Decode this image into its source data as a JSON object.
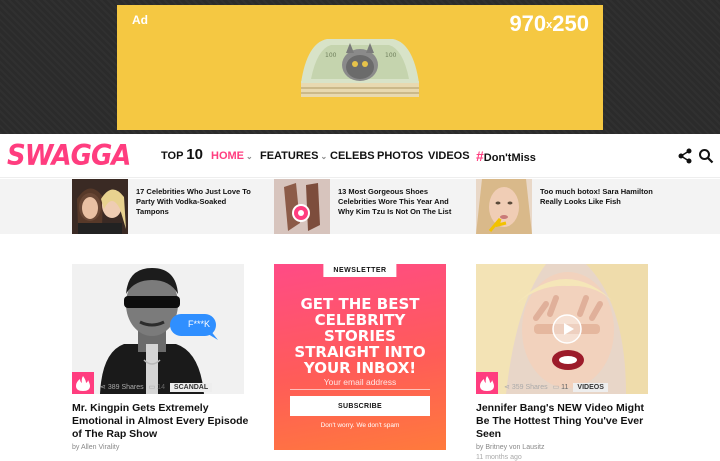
{
  "ad": {
    "label": "Ad",
    "size": "970",
    "size_x": "x",
    "size_h": "250"
  },
  "nav": {
    "logo": "SWAGGA",
    "top": "TOP",
    "top_num": "10",
    "home": "HOME",
    "features": "FEATURES",
    "celebs": "CELEBS",
    "photos": "PHOTOS",
    "videos": "VIDEOS",
    "hash": "#",
    "dontmiss": "Don'tMiss"
  },
  "trending": [
    {
      "title": "17 Celebrities Who Just Love To Party With Vodka-Soaked Tampons"
    },
    {
      "title": "13 Most Gorgeous Shoes Celebrities Wore This Year And Why Kim Tzu Is Not On The List"
    },
    {
      "title": "Too much botox! Sara Hamilton Really Looks Like Fish"
    }
  ],
  "cards": [
    {
      "bubble": "F***K",
      "shares": "389 Shares",
      "comments": "14",
      "tag": "SCANDAL",
      "title": "Mr. Kingpin Gets Extremely Emotional in Almost Every Episode of The Rap Show",
      "author": "by Allen Virality",
      "time": ""
    },
    {
      "shares": "359 Shares",
      "comments": "11",
      "tag": "VIDEOS",
      "title": "Jennifer Bang's NEW Video Might Be The Hottest Thing You've Ever Seen",
      "author": "by Britney von Lausitz",
      "time": "11 months ago"
    }
  ],
  "newsletter": {
    "label": "NEWSLETTER",
    "headline": "GET THE BEST CELEBRITY STORIES STRAIGHT INTO YOUR INBOX!",
    "placeholder": "Your email address",
    "button": "SUBSCRIBE",
    "note": "Don't worry. We don't spam"
  },
  "colors": {
    "brand": "#ff3d7f",
    "ad_bg": "#f5c842"
  },
  "icons": [
    "share-icon",
    "search-icon",
    "fire-icon",
    "play-icon",
    "comment-icon"
  ]
}
